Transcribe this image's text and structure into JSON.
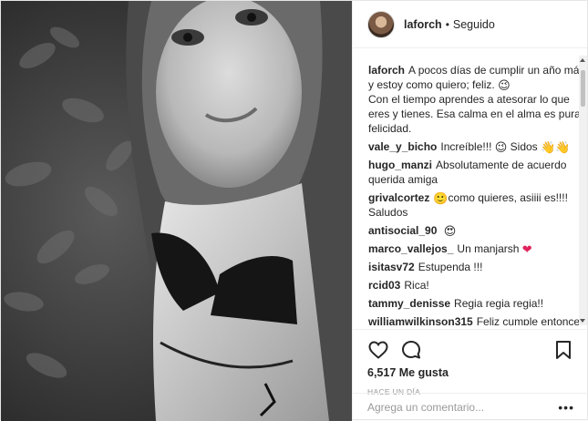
{
  "header": {
    "username": "laforch",
    "separator": "•",
    "follow_status": "Seguido"
  },
  "caption": {
    "username": "laforch",
    "text": "A pocos días de cumplir un año más y estoy como quiero; feliz.",
    "emoji": "😉",
    "text2": "Con el tiempo aprendes a atesorar lo que eres y tienes. Esa calma en el alma es pura felicidad."
  },
  "comments": [
    {
      "user": "vale_y_bicho",
      "text": "Increíble!!!",
      "emoji": "😉",
      "text2": "Sidos",
      "emoji2": "👋👋"
    },
    {
      "user": "hugo_manzi",
      "text": "Absolutamente de acuerdo querida amiga"
    },
    {
      "user": "grivalcortez",
      "emoji": "🙂",
      "text": "como quieres, asiiii es!!!!",
      "text2": "Saludos"
    },
    {
      "user": "antisocial_90",
      "emoji": "😍"
    },
    {
      "user": "marco_vallejos_",
      "text": "Un manjarsh",
      "emoji": "❤"
    },
    {
      "user": "isitasv72",
      "text": "Estupenda !!!"
    },
    {
      "user": "rcid03",
      "text": "Rica!"
    },
    {
      "user": "tammy_denisse",
      "text": "Regia regia regia!!"
    },
    {
      "user": "williamwilkinson315",
      "text": "Feliz cumple entonces"
    }
  ],
  "actions": {
    "likes": "6,517 Me gusta",
    "time": "HACE UN DÍA"
  },
  "add_comment": {
    "placeholder": "Agrega un comentario...",
    "more": "•••"
  },
  "icons": {
    "like": "heart-outline-icon",
    "comment": "comment-bubble-icon",
    "save": "bookmark-icon"
  }
}
